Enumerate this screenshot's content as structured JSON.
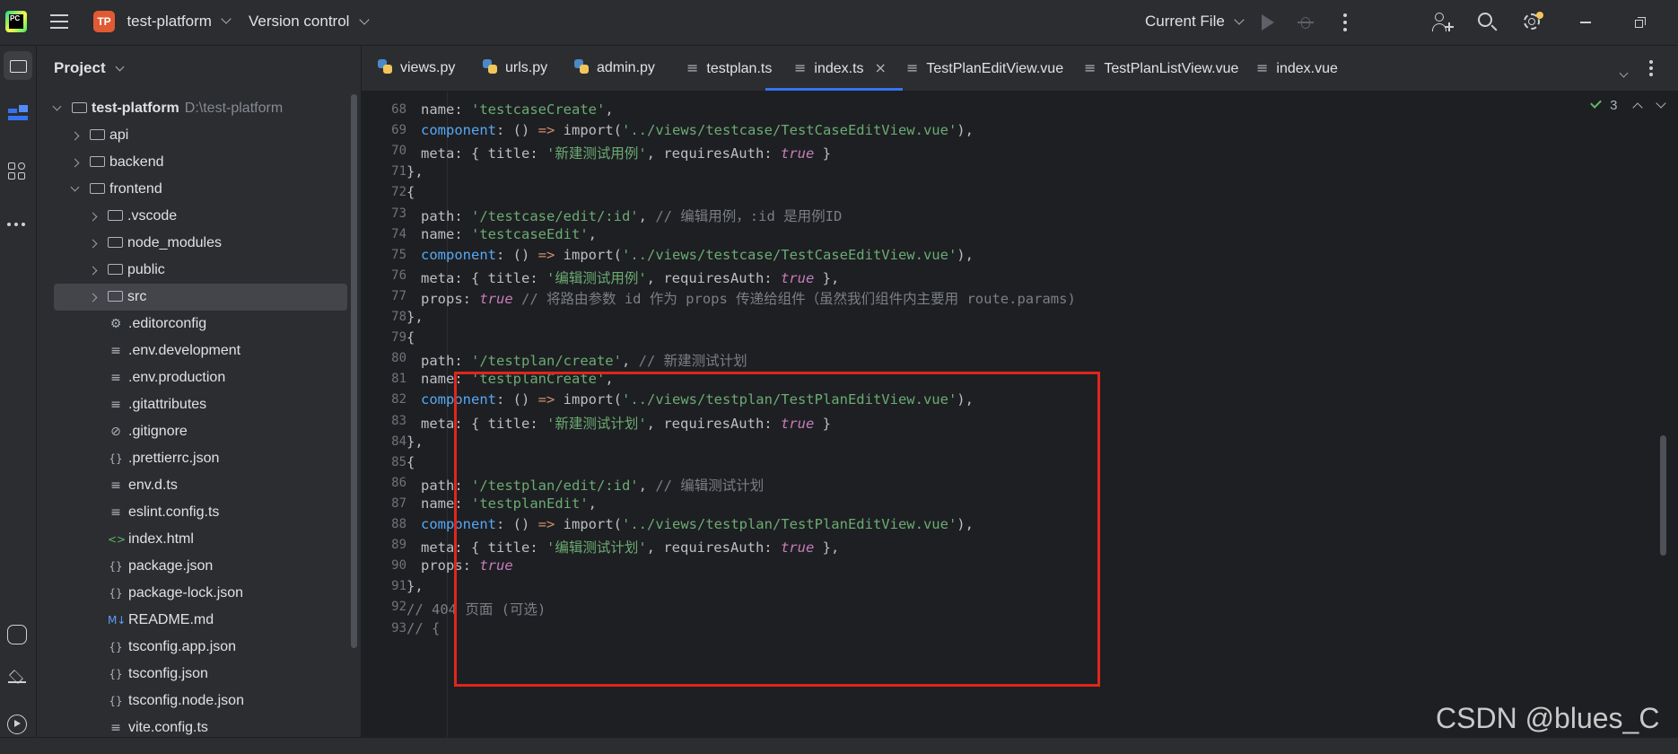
{
  "titlebar": {
    "app_logo": "PC",
    "project_badge": "TP",
    "project_name": "test-platform",
    "vcs": "Version control",
    "run_config": "Current File"
  },
  "project_panel": {
    "title": "Project",
    "tree": [
      {
        "label": "test-platform",
        "meta": "D:\\test-platform",
        "icon": "folder-icon",
        "kind": "folder",
        "depth": 0,
        "expanded": true
      },
      {
        "label": "api",
        "icon": "package-folder-icon",
        "kind": "folder",
        "depth": 1,
        "expanded": false
      },
      {
        "label": "backend",
        "icon": "package-folder-icon",
        "kind": "folder",
        "depth": 1,
        "expanded": false
      },
      {
        "label": "frontend",
        "icon": "folder-icon",
        "kind": "folder",
        "depth": 1,
        "expanded": true
      },
      {
        "label": ".vscode",
        "icon": "folder-icon",
        "kind": "folder",
        "depth": 2,
        "expanded": false
      },
      {
        "label": "node_modules",
        "icon": "folder-icon",
        "kind": "folder",
        "depth": 2,
        "expanded": false
      },
      {
        "label": "public",
        "icon": "folder-icon",
        "kind": "folder",
        "depth": 2,
        "expanded": false
      },
      {
        "label": "src",
        "icon": "folder-icon",
        "kind": "folder",
        "depth": 2,
        "expanded": false,
        "selected": true
      },
      {
        "label": ".editorconfig",
        "icon": "gear-icon",
        "kind": "file",
        "depth": 2
      },
      {
        "label": ".env.development",
        "icon": "text-file-icon",
        "kind": "file",
        "depth": 2
      },
      {
        "label": ".env.production",
        "icon": "text-file-icon",
        "kind": "file",
        "depth": 2
      },
      {
        "label": ".gitattributes",
        "icon": "text-file-icon",
        "kind": "file",
        "depth": 2
      },
      {
        "label": ".gitignore",
        "icon": "ignore-file-icon",
        "kind": "file",
        "depth": 2
      },
      {
        "label": ".prettierrc.json",
        "icon": "json-file-icon",
        "kind": "file",
        "depth": 2
      },
      {
        "label": "env.d.ts",
        "icon": "text-file-icon",
        "kind": "file",
        "depth": 2
      },
      {
        "label": "eslint.config.ts",
        "icon": "text-file-icon",
        "kind": "file",
        "depth": 2
      },
      {
        "label": "index.html",
        "icon": "html-file-icon",
        "kind": "file",
        "depth": 2
      },
      {
        "label": "package.json",
        "icon": "json-file-icon",
        "kind": "file",
        "depth": 2
      },
      {
        "label": "package-lock.json",
        "icon": "json-file-icon",
        "kind": "file",
        "depth": 2
      },
      {
        "label": "README.md",
        "icon": "markdown-file-icon",
        "kind": "file",
        "depth": 2
      },
      {
        "label": "tsconfig.app.json",
        "icon": "json-file-icon",
        "kind": "file",
        "depth": 2
      },
      {
        "label": "tsconfig.json",
        "icon": "json-file-icon",
        "kind": "file",
        "depth": 2
      },
      {
        "label": "tsconfig.node.json",
        "icon": "json-file-icon",
        "kind": "file",
        "depth": 2
      },
      {
        "label": "vite.config.ts",
        "icon": "text-file-icon",
        "kind": "file",
        "depth": 2
      }
    ]
  },
  "tabs": [
    {
      "label": "views.py",
      "icon": "python-file-icon"
    },
    {
      "label": "urls.py",
      "icon": "python-file-icon"
    },
    {
      "label": "admin.py",
      "icon": "python-file-icon"
    },
    {
      "label": "testplan.ts",
      "icon": "text-file-icon"
    },
    {
      "label": "index.ts",
      "icon": "text-file-icon",
      "active": true,
      "closable": true
    },
    {
      "label": "TestPlanEditView.vue",
      "icon": "text-file-icon"
    },
    {
      "label": "TestPlanListView.vue",
      "icon": "text-file-icon"
    },
    {
      "label": "index.vue",
      "icon": "text-file-icon"
    }
  ],
  "editor": {
    "check_count": "3",
    "lines": [
      {
        "n": "68",
        "indent": 2,
        "tokens": [
          [
            "key",
            "name: "
          ],
          [
            "str",
            "'testcaseCreate'"
          ],
          [
            "key",
            ","
          ]
        ]
      },
      {
        "n": "69",
        "indent": 2,
        "tokens": [
          [
            "fn",
            "component"
          ],
          [
            "key",
            ": () "
          ],
          [
            "kw",
            "=>"
          ],
          [
            "key",
            " import("
          ],
          [
            "str",
            "'../views/testcase/TestCaseEditView.vue'"
          ],
          [
            "key",
            "),"
          ]
        ]
      },
      {
        "n": "70",
        "indent": 2,
        "tokens": [
          [
            "key",
            "meta: { title: "
          ],
          [
            "str",
            "'新建测试用例'"
          ],
          [
            "key",
            ", requiresAuth: "
          ],
          [
            "bool",
            "true"
          ],
          [
            "key",
            " }"
          ]
        ]
      },
      {
        "n": "71",
        "indent": 1,
        "tokens": [
          [
            "key",
            "},"
          ]
        ]
      },
      {
        "n": "72",
        "indent": 1,
        "tokens": [
          [
            "key",
            "{"
          ]
        ]
      },
      {
        "n": "73",
        "indent": 2,
        "tokens": [
          [
            "key",
            "path: "
          ],
          [
            "str",
            "'/testcase/edit/:id'"
          ],
          [
            "key",
            ", "
          ],
          [
            "cmt",
            "// 编辑用例，:id 是用例ID"
          ]
        ]
      },
      {
        "n": "74",
        "indent": 2,
        "tokens": [
          [
            "key",
            "name: "
          ],
          [
            "str",
            "'testcaseEdit'"
          ],
          [
            "key",
            ","
          ]
        ]
      },
      {
        "n": "75",
        "indent": 2,
        "tokens": [
          [
            "fn",
            "component"
          ],
          [
            "key",
            ": () "
          ],
          [
            "kw",
            "=>"
          ],
          [
            "key",
            " import("
          ],
          [
            "str",
            "'../views/testcase/TestCaseEditView.vue'"
          ],
          [
            "key",
            "),"
          ]
        ]
      },
      {
        "n": "76",
        "indent": 2,
        "tokens": [
          [
            "key",
            "meta: { title: "
          ],
          [
            "str",
            "'编辑测试用例'"
          ],
          [
            "key",
            ", requiresAuth: "
          ],
          [
            "bool",
            "true"
          ],
          [
            "key",
            " },"
          ]
        ]
      },
      {
        "n": "77",
        "indent": 2,
        "tokens": [
          [
            "key",
            "props: "
          ],
          [
            "bool",
            "true"
          ],
          [
            "key",
            " "
          ],
          [
            "cmt",
            "// 将路由参数 id 作为 props 传递给组件（虽然我们组件内主要用 route.params)"
          ]
        ]
      },
      {
        "n": "78",
        "indent": 1,
        "tokens": [
          [
            "key",
            "},"
          ]
        ]
      },
      {
        "n": "79",
        "indent": 1,
        "tokens": [
          [
            "key",
            "{"
          ]
        ]
      },
      {
        "n": "80",
        "indent": 2,
        "tokens": [
          [
            "key",
            "path: "
          ],
          [
            "str",
            "'/testplan/create'"
          ],
          [
            "key",
            ", "
          ],
          [
            "cmt",
            "// 新建测试计划"
          ]
        ]
      },
      {
        "n": "81",
        "indent": 2,
        "tokens": [
          [
            "key",
            "name: "
          ],
          [
            "str",
            "'testplanCreate'"
          ],
          [
            "key",
            ","
          ]
        ]
      },
      {
        "n": "82",
        "indent": 2,
        "tokens": [
          [
            "fn",
            "component"
          ],
          [
            "key",
            ": () "
          ],
          [
            "kw",
            "=>"
          ],
          [
            "key",
            " import("
          ],
          [
            "str",
            "'../views/testplan/TestPlanEditView.vue'"
          ],
          [
            "key",
            "),"
          ]
        ]
      },
      {
        "n": "83",
        "indent": 2,
        "tokens": [
          [
            "key",
            "meta: { title: "
          ],
          [
            "str",
            "'新建测试计划'"
          ],
          [
            "key",
            ", requiresAuth: "
          ],
          [
            "bool",
            "true"
          ],
          [
            "key",
            " }"
          ]
        ]
      },
      {
        "n": "84",
        "indent": 1,
        "tokens": [
          [
            "key",
            "},"
          ]
        ]
      },
      {
        "n": "85",
        "indent": 1,
        "tokens": [
          [
            "key",
            "{"
          ]
        ]
      },
      {
        "n": "86",
        "indent": 2,
        "tokens": [
          [
            "key",
            "path: "
          ],
          [
            "str",
            "'/testplan/edit/:id'"
          ],
          [
            "key",
            ", "
          ],
          [
            "cmt",
            "// 编辑测试计划"
          ]
        ]
      },
      {
        "n": "87",
        "indent": 2,
        "tokens": [
          [
            "key",
            "name: "
          ],
          [
            "str",
            "'testplanEdit'"
          ],
          [
            "key",
            ","
          ]
        ]
      },
      {
        "n": "88",
        "indent": 2,
        "tokens": [
          [
            "fn",
            "component"
          ],
          [
            "key",
            ": () "
          ],
          [
            "kw",
            "=>"
          ],
          [
            "key",
            " import("
          ],
          [
            "str",
            "'../views/testplan/TestPlanEditView.vue'"
          ],
          [
            "key",
            "),"
          ]
        ]
      },
      {
        "n": "89",
        "indent": 2,
        "tokens": [
          [
            "key",
            "meta: { title: "
          ],
          [
            "str",
            "'编辑测试计划'"
          ],
          [
            "key",
            ", requiresAuth: "
          ],
          [
            "bool",
            "true"
          ],
          [
            "key",
            " },"
          ]
        ]
      },
      {
        "n": "90",
        "indent": 2,
        "tokens": [
          [
            "key",
            "props: "
          ],
          [
            "bool",
            "true"
          ]
        ]
      },
      {
        "n": "91",
        "indent": 1,
        "tokens": [
          [
            "key",
            "},"
          ]
        ]
      },
      {
        "n": "92",
        "indent": 1,
        "tokens": [
          [
            "cmt",
            "// 404 页面 (可选)"
          ]
        ]
      },
      {
        "n": "93",
        "indent": 1,
        "tokens": [
          [
            "cmt",
            "// {"
          ]
        ]
      }
    ]
  },
  "watermark": "CSDN @blues_C",
  "colors": {
    "accent": "#3574f0",
    "highlight_box": "#e0261c"
  }
}
